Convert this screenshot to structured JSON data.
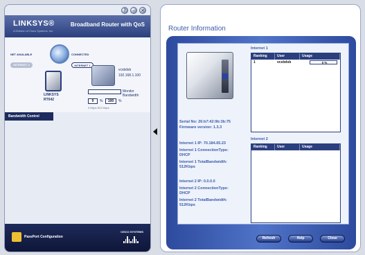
{
  "left_panel": {
    "logo": "LINKSYS®",
    "logo_sub": "A Division of Cisco Systems, Inc.",
    "product_title": "Broadband Router with QoS",
    "window_controls": [
      "?",
      "–",
      "×"
    ],
    "net_label": "NET AVAILABLE",
    "connected_label": "CONNECTED",
    "internet2_label": "INTERNET 2",
    "internet1_label": "INTERNET 1",
    "router_name": "LINKSYS",
    "router_model": "RT042",
    "pc_name": "vcsbdsb",
    "pc_ip": "192.168.1.100",
    "meter_label": "Monitor",
    "meter_label2": "Bandwidth",
    "meter_pct_value": "0",
    "meter_pct_unit": "%",
    "meter_max_value": "100",
    "meter_max_unit": "%",
    "meter_range": "0  Kbps   512 Kbps",
    "meter_level": 0.0,
    "bandwidth_tab": "Bandwidth Control",
    "passport_label": "PassPort Configuration",
    "cisco_label": "CISCO SYSTEMS"
  },
  "right_panel": {
    "title": "Router Information",
    "serial": "Serial No: 26:b7:42:9b:3b:75",
    "firmware": "Firmware version: 1.3.3",
    "inet1_ip": "Internet 1 IP: 70.184.65.23",
    "inet1_conn": "Internet 1 ConnectionType:",
    "inet1_conn_val": "DHCP",
    "inet1_bw": "Internet 1 TotalBandwidth:",
    "inet1_bw_val": "512Kbps",
    "inet2_ip": "Internet 2 IP: 0.0.0.0",
    "inet2_conn": "Internet 2 ConnectionType:",
    "inet2_conn_val": "DHCP",
    "inet2_bw": "Internet 2 TotalBandwidth:",
    "inet2_bw_val": "512Kbps",
    "internet1_header": "Internet 1",
    "internet2_header": "Internet 2",
    "table_columns": [
      "Ranking",
      "User",
      "Usage"
    ],
    "internet1_rows": [
      {
        "ranking": "1",
        "user": "vcsbdsb",
        "usage": "0  %"
      }
    ],
    "buttons": {
      "refresh": "Refresh",
      "help": "Help",
      "close": "Close"
    }
  }
}
